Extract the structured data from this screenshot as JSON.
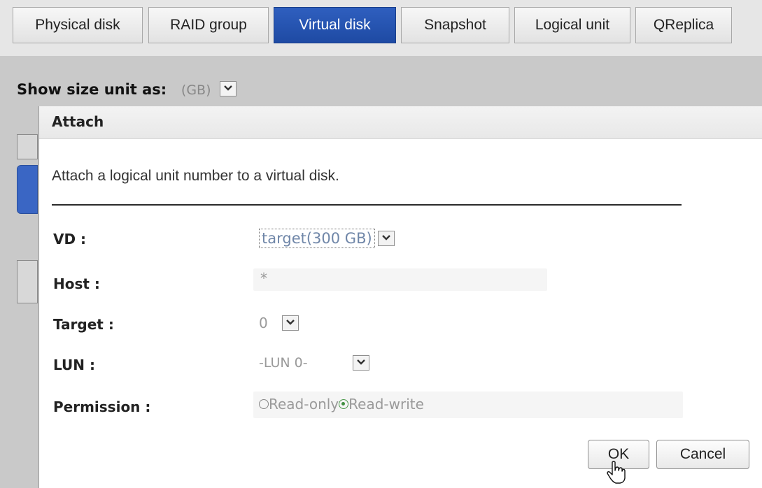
{
  "tabs": [
    {
      "label": "Physical disk",
      "active": false
    },
    {
      "label": "RAID group",
      "active": false
    },
    {
      "label": "Virtual disk",
      "active": true
    },
    {
      "label": "Snapshot",
      "active": false
    },
    {
      "label": "Logical unit",
      "active": false
    },
    {
      "label": "QReplica",
      "active": false
    }
  ],
  "size_unit": {
    "label": "Show size unit as:",
    "value": "(GB)"
  },
  "dialog": {
    "title": "Attach",
    "description": "Attach a logical unit number to a virtual disk.",
    "fields": {
      "vd": {
        "label": "VD :",
        "value": "target(300 GB)"
      },
      "host": {
        "label": "Host :",
        "value": "*"
      },
      "target": {
        "label": "Target :",
        "value": "0"
      },
      "lun": {
        "label": "LUN :",
        "value": "-LUN 0-"
      },
      "permission": {
        "label": "Permission :",
        "options": [
          {
            "label": "Read-only",
            "selected": false
          },
          {
            "label": "Read-write",
            "selected": true
          }
        ]
      }
    },
    "buttons": {
      "ok": "OK",
      "cancel": "Cancel"
    }
  },
  "colors": {
    "active_tab": "#1e4aa3",
    "selected_radio": "#3f8f3f",
    "select_text": "#6f86a8"
  }
}
